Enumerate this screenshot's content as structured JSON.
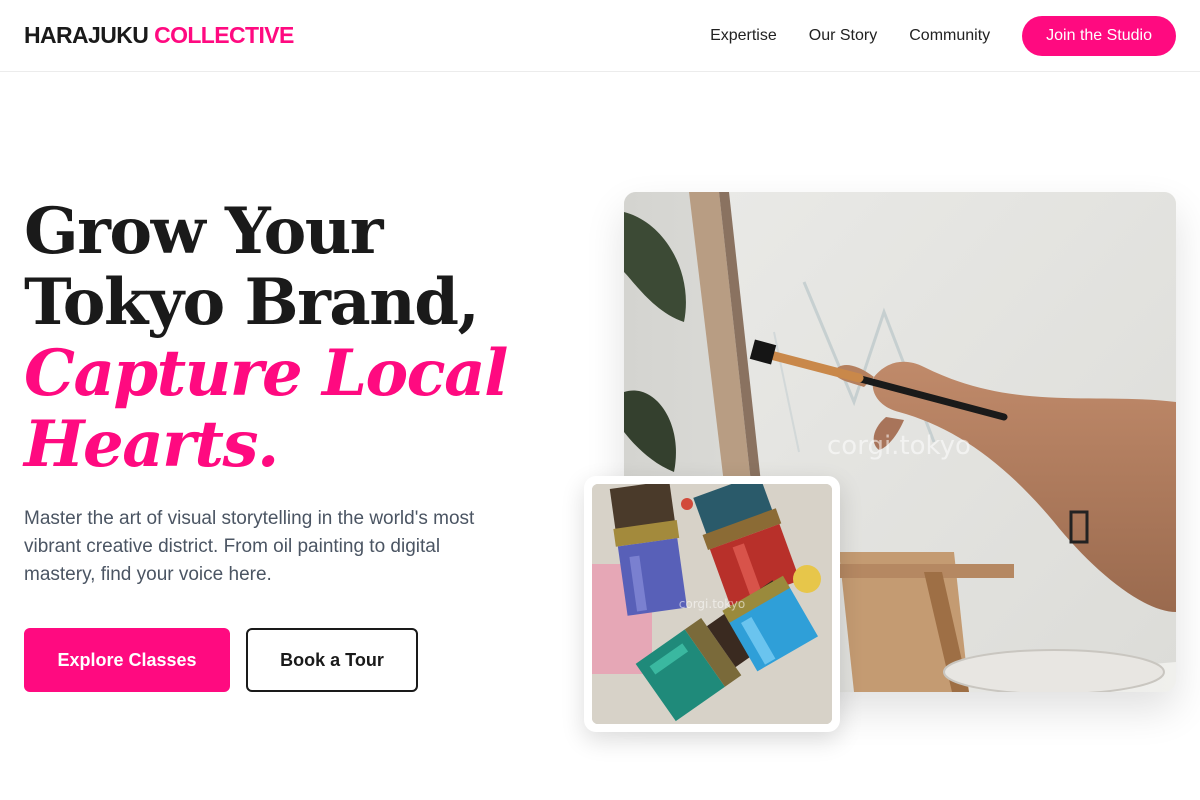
{
  "header": {
    "logo_part1": "HARAJUKU",
    "logo_part2": "COLLECTIVE",
    "nav": [
      "Expertise",
      "Our Story",
      "Community"
    ],
    "cta_label": "Join the Studio"
  },
  "hero": {
    "title_line1": "Grow Your",
    "title_line2": "Tokyo Brand,",
    "title_accent_line1": "Capture Local",
    "title_accent_line2": "Hearts.",
    "description": "Master the art of visual storytelling in the world's most vibrant creative district. From oil painting to digital mastery, find your voice here.",
    "primary_button": "Explore Classes",
    "secondary_button": "Book a Tour"
  },
  "images": {
    "main_watermark": "corgi.tokyo",
    "inset_watermark": "corgi.tokyo"
  },
  "colors": {
    "accent": "#ff0a80",
    "text_dark": "#1a1a1a",
    "text_muted": "#4b5563"
  }
}
